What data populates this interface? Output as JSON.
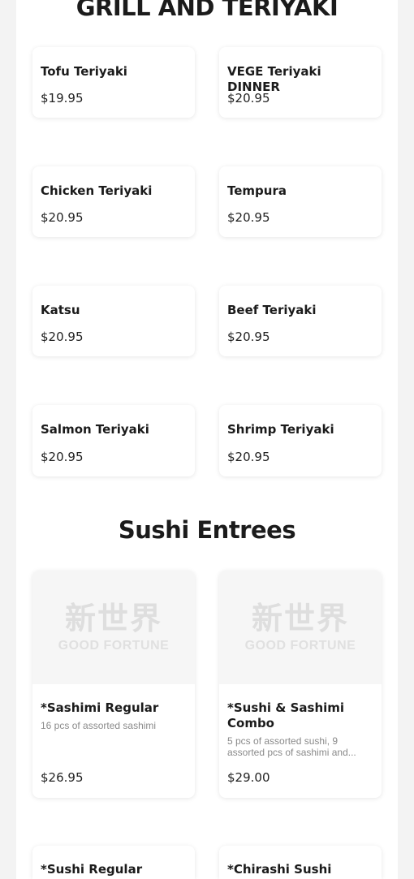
{
  "sections": {
    "grill": {
      "title": "GRILL AND TERIYAKI"
    },
    "sushi": {
      "title": "Sushi Entrees"
    }
  },
  "grill_items": [
    {
      "name": "Tofu Teriyaki",
      "price": "$19.95"
    },
    {
      "name": "VEGE Teriyaki DINNER",
      "price": "$20.95"
    },
    {
      "name": "Chicken Teriyaki",
      "price": "$20.95"
    },
    {
      "name": "Tempura",
      "price": "$20.95"
    },
    {
      "name": "Katsu",
      "price": "$20.95"
    },
    {
      "name": "Beef Teriyaki",
      "price": "$20.95"
    },
    {
      "name": "Salmon Teriyaki",
      "price": "$20.95"
    },
    {
      "name": "Shrimp Teriyaki",
      "price": "$20.95"
    }
  ],
  "sushi_items": [
    {
      "name": "*Sashimi Regular",
      "description": "16 pcs of assorted sashimi",
      "price": "$26.95",
      "image_logo": {
        "cn": "新世界",
        "en": "GOOD FORTUNE"
      }
    },
    {
      "name": "*Sushi & Sashimi Combo",
      "description": "5 pcs of assorted sushi, 9 assorted pcs of sashimi and...",
      "price": "$29.00",
      "image_logo": {
        "cn": "新世界",
        "en": "GOOD FORTUNE"
      }
    },
    {
      "name": "*Sushi Regular"
    },
    {
      "name": "*Chirashi Sushi"
    }
  ],
  "colors": {
    "page_background": "#f3f3f3",
    "card_background": "#ffffff",
    "text": "#1b1b1b",
    "muted_text": "#8a8a8a",
    "image_placeholder": "#f6f6f6"
  }
}
